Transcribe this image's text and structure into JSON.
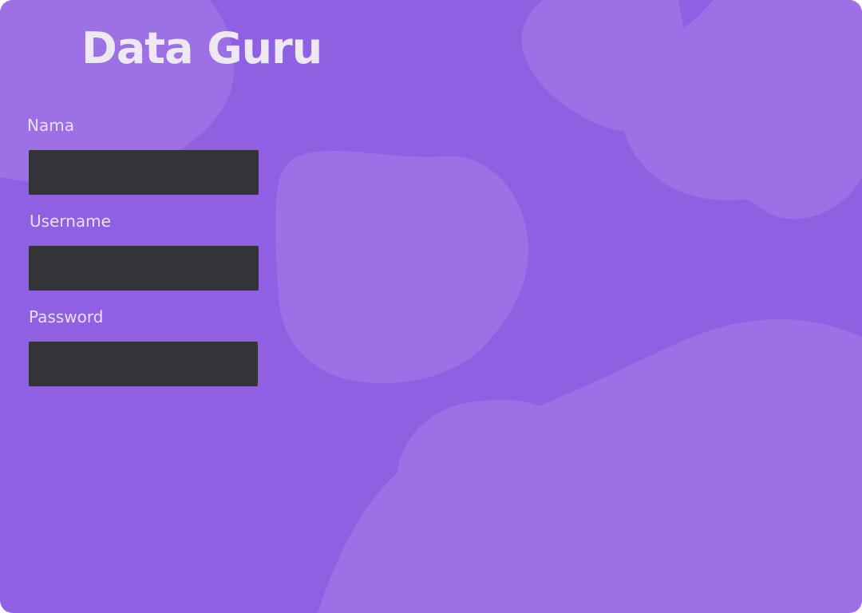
{
  "app": {
    "title": "Data Guru"
  },
  "form": {
    "fields": [
      {
        "label": "Nama",
        "value": ""
      },
      {
        "label": "Username",
        "value": ""
      },
      {
        "label": "Password",
        "value": ""
      }
    ]
  },
  "colors": {
    "background": "#8f60e2",
    "blob": "#9d70e5",
    "title_text": "#ece9f3",
    "label_text": "#e8dff8",
    "input_fill": "#343438"
  }
}
